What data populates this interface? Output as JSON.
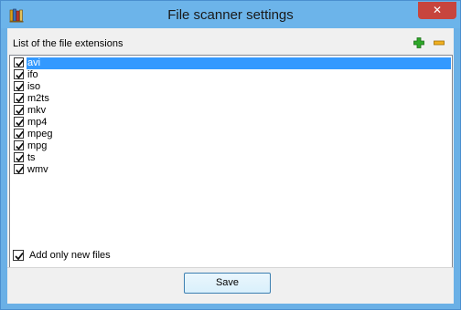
{
  "window": {
    "title": "File scanner settings",
    "close_glyph": "✕",
    "app_icon": "bookshelf-icon"
  },
  "list": {
    "header": "List of the file extensions",
    "add_icon": "add-plus-icon",
    "remove_icon": "remove-minus-icon",
    "items": [
      {
        "label": "avi",
        "checked": true,
        "selected": true
      },
      {
        "label": "ifo",
        "checked": true,
        "selected": false
      },
      {
        "label": "iso",
        "checked": true,
        "selected": false
      },
      {
        "label": "m2ts",
        "checked": true,
        "selected": false
      },
      {
        "label": "mkv",
        "checked": true,
        "selected": false
      },
      {
        "label": "mp4",
        "checked": true,
        "selected": false
      },
      {
        "label": "mpeg",
        "checked": true,
        "selected": false
      },
      {
        "label": "mpg",
        "checked": true,
        "selected": false
      },
      {
        "label": "ts",
        "checked": true,
        "selected": false
      },
      {
        "label": "wmv",
        "checked": true,
        "selected": false
      }
    ]
  },
  "options": {
    "add_only_new_label": "Add only new files",
    "add_only_new_checked": true
  },
  "buttons": {
    "save_label": "Save"
  },
  "colors": {
    "selection": "#3399ff",
    "titlebar": "#6cb4ea",
    "close": "#c7453d",
    "add_green": "#2ea829",
    "remove_orange": "#f0b020"
  }
}
